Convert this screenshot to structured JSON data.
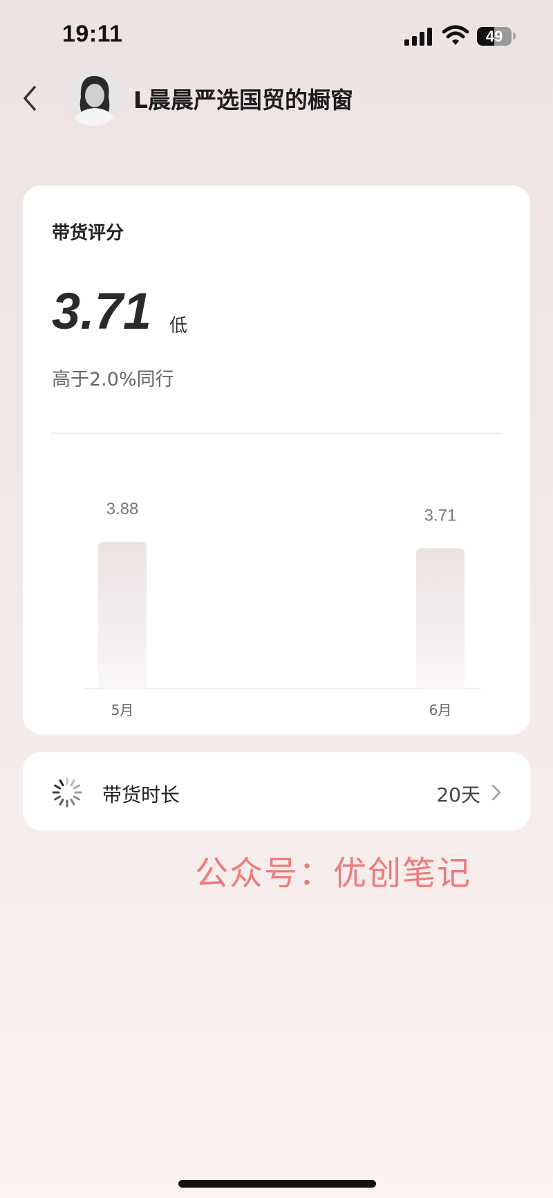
{
  "status_bar": {
    "time": "19:11",
    "battery_level": "49",
    "icons": [
      "signal-icon",
      "wifi-icon",
      "battery-icon"
    ]
  },
  "header": {
    "title": "L晨晨严选国贸的橱窗",
    "back_icon": "back-chevron-icon"
  },
  "score_card": {
    "title": "带货评分",
    "score": "3.71",
    "level": "低",
    "compare_text": "高于2.0%同行"
  },
  "chart_data": {
    "type": "bar",
    "categories": [
      "5月",
      "6月"
    ],
    "values": [
      3.88,
      3.71
    ],
    "value_labels": [
      "3.88",
      "3.71"
    ],
    "title": "",
    "xlabel": "",
    "ylabel": "",
    "colors": {
      "bar_top": "#ece2e2",
      "bar_bottom": "#f9f7f7"
    }
  },
  "duration_card": {
    "label": "带货时长",
    "value": "20天",
    "icon": "loading-spinner-icon"
  },
  "watermark": "公众号：优创笔记"
}
